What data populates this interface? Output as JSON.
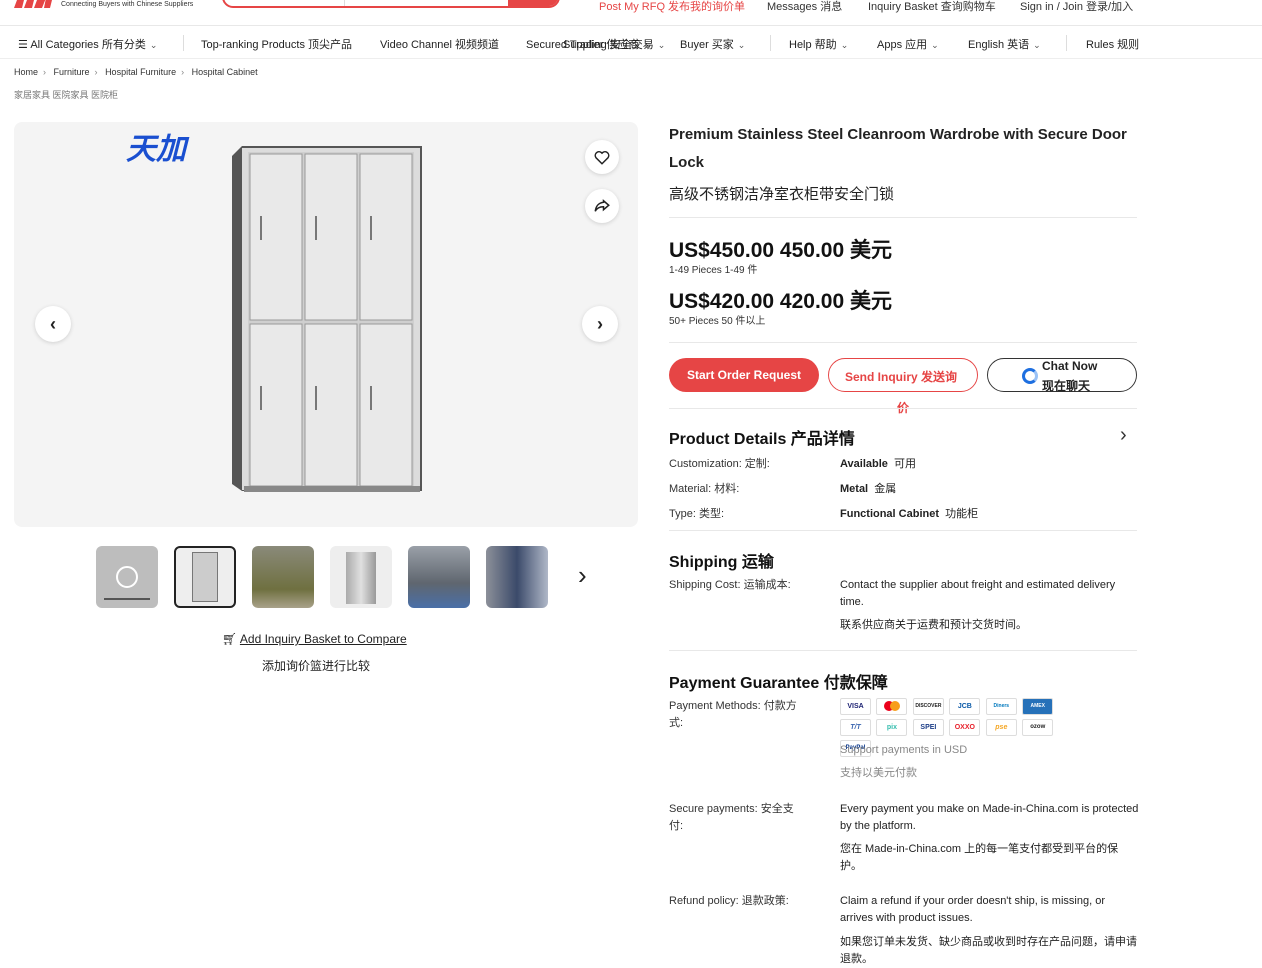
{
  "header": {
    "tagline": "Connecting Buyers with Chinese Suppliers",
    "post_rfq": "Post My RFQ  发布我的询价单",
    "messages": "Messages  消息",
    "inquiry_basket": "Inquiry Basket  查询购物车",
    "sign_in": "Sign in / Join  登录/加入"
  },
  "nav": {
    "all_categories": "All Categories  所有分类",
    "top_ranking": "Top-ranking Products   顶尖产品",
    "video_channel": "Video Channel   视频频道",
    "secured_trading": "Secured Trading  安全交易",
    "supplier": "Supplier  供应商",
    "buyer": "Buyer  买家",
    "help": "Help  帮助",
    "apps": "Apps  应用",
    "language": "English  英语",
    "rules": "Rules  规则"
  },
  "breadcrumb": {
    "items": [
      "Home",
      "Furniture",
      "Hospital Furniture",
      "Hospital Cabinet"
    ],
    "cn": "家居家具  医院家具  医院柜"
  },
  "gallery": {
    "compare": "Add Inquiry Basket to Compare",
    "compare_cn": "添加询价篮进行比较",
    "brand_mark": "天加"
  },
  "product": {
    "title": "Premium Stainless Steel Cleanroom Wardrobe with Secure Door Lock",
    "title_cn": "高级不锈钢洁净室衣柜带安全门锁",
    "prices": [
      {
        "price": "US$450.00   450.00 美元",
        "qty": "1-49 Pieces  1-49 件"
      },
      {
        "price": "US$420.00   420.00 美元",
        "qty": "50+ Pieces  50 件以上"
      }
    ],
    "start_order": "Start Order Request",
    "send_inquiry": "Send Inquiry  发送询",
    "send_inquiry_2": "价",
    "chat_now": "Chat Now",
    "chat_now_cn": "现在聊天"
  },
  "details": {
    "title": "Product Details  产品详情",
    "rows": [
      {
        "label": "Customization:  定制:",
        "value": "Available  可用",
        "value_bold": "Available",
        "value_cn": "可用"
      },
      {
        "label": "Material:  材料:",
        "value_bold": "Metal",
        "value_cn": "金属"
      },
      {
        "label": "Type:  类型:",
        "value_bold": "Functional Cabinet",
        "value_cn": "功能柜"
      }
    ]
  },
  "shipping": {
    "title": "Shipping  运输",
    "label": "Shipping Cost:  运输成本:",
    "value": "Contact the supplier about freight and estimated delivery time.",
    "value_cn": "联系供应商关于运费和预计交货时间。"
  },
  "payment": {
    "title": "Payment Guarantee  付款保障",
    "methods_label": "Payment Methods:  付款方式:",
    "support": "Support payments in USD",
    "support_cn": "支持以美元付款",
    "secure_label": "Secure payments:  安全支付:",
    "secure_value": "Every payment you make on Made-in-China.com is protected by the platform.",
    "secure_cn": "您在 Made-in-China.com 上的每一笔支付都受到平台的保护。",
    "refund_label": "Refund policy:  退款政策:",
    "refund_value": "Claim a refund if your order doesn't ship, is missing, or arrives with product issues.",
    "refund_cn": "如果您订单未发货、缺少商品或收到时存在产品问题，请申请退款。",
    "icons": [
      "VISA",
      "MC",
      "DISCOVER",
      "JCB",
      "Diners",
      "AMEX",
      "T/T",
      "pix",
      "SPEI",
      "OXXO",
      "pse",
      "ozow",
      "PayPal"
    ]
  },
  "colors": {
    "accent": "#e64545",
    "chat_blue": "#1e6fe0"
  }
}
